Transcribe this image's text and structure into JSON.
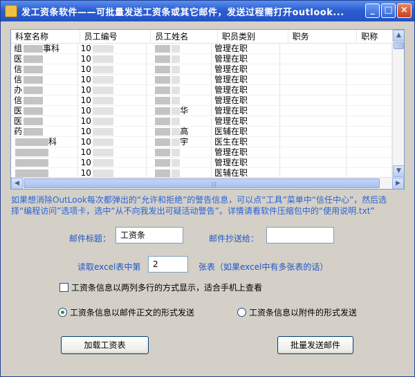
{
  "window": {
    "title": "发工资条软件——可批量发送工资条或其它邮件，发送过程需打开outlook..."
  },
  "grid": {
    "columns": [
      "科室名称",
      "员工编号",
      "员工姓名",
      "职员类别",
      "职务",
      "职称"
    ],
    "rows": [
      {
        "dept": "组",
        "dept_suffix": "事科",
        "id": "10",
        "name_suffix": "",
        "category": "管理在职"
      },
      {
        "dept": "医",
        "dept_suffix": "",
        "id": "10",
        "name_suffix": "",
        "category": "管理在职"
      },
      {
        "dept": "信",
        "dept_suffix": "",
        "id": "10",
        "name_suffix": "",
        "category": "管理在职"
      },
      {
        "dept": "信",
        "dept_suffix": "",
        "id": "10",
        "name_suffix": "",
        "category": "管理在职"
      },
      {
        "dept": "办",
        "dept_suffix": "",
        "id": "10",
        "name_suffix": "",
        "category": "管理在职"
      },
      {
        "dept": "信",
        "dept_suffix": "",
        "id": "10",
        "name_suffix": "",
        "category": "管理在职"
      },
      {
        "dept": "医",
        "dept_suffix": "",
        "id": "10",
        "name_suffix": "华",
        "category": "管理在职"
      },
      {
        "dept": "医",
        "dept_suffix": "",
        "id": "10",
        "name_suffix": "",
        "category": "管理在职"
      },
      {
        "dept": "药",
        "dept_suffix": "",
        "id": "10",
        "name_suffix": "高",
        "category": "医辅在职"
      },
      {
        "dept": "",
        "dept_suffix": "科",
        "id": "10",
        "name_suffix": "宇",
        "category": "医生在职"
      },
      {
        "dept": "",
        "dept_suffix": "",
        "id": "10",
        "name_suffix": "",
        "category": "管理在职"
      },
      {
        "dept": "",
        "dept_suffix": "",
        "id": "10",
        "name_suffix": "",
        "category": "管理在职"
      },
      {
        "dept": "",
        "dept_suffix": "",
        "id": "10",
        "name_suffix": "",
        "category": "医辅在职"
      }
    ]
  },
  "notice": "如果想消除OutLook每次都弹出的“允许和拒绝”的警告信息，可以点“工具”菜单中“信任中心”，然后选择“编程访问”选项卡，选中“从不向我发出可疑活动警告”。详情请看软件压缩包中的“使用说明.txt”",
  "form": {
    "subject_label": "邮件标题：",
    "subject_value": "工资条",
    "cc_label": "邮件抄送给：",
    "cc_value": "",
    "sheet_label": "读取excel表中第",
    "sheet_value": "2",
    "sheet_suffix": "张表（如果excel中有多张表的话）",
    "mobile_checkbox_label": "工资条信息以两列多行的方式显示，适合手机上查看",
    "radio_body_label": "工资条信息以邮件正文的形式发送",
    "radio_attach_label": "工资条信息以附件的形式发送",
    "load_button": "加载工资表",
    "send_button": "批量发送邮件"
  },
  "icons": [
    "app-icon",
    "minimize-icon",
    "maximize-icon",
    "close-icon",
    "scroll-up-icon",
    "scroll-down-icon",
    "scroll-left-icon",
    "scroll-right-icon"
  ]
}
